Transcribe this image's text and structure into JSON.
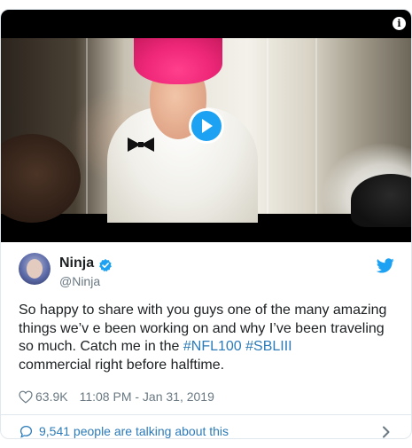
{
  "tweet": {
    "author_name": "Ninja",
    "author_handle": "@Ninja",
    "text_before": "So happy to share with you guys one of the many amazing things we’v e been working on and why I’ve been traveling so much. Catch me in the ",
    "hashtags": [
      "#NFL100",
      "#SBLIII"
    ],
    "text_after": "commercial right before halftime.",
    "likes": "63.9K",
    "timestamp": "11:08 PM - Jan 31, 2019",
    "conversation": "9,541 people are talking about this"
  },
  "video": {
    "info_glyph": "i"
  },
  "icons": {
    "play": "play-icon",
    "info": "info-icon",
    "verified": "verified-badge-icon",
    "bird": "twitter-bird-icon",
    "heart": "heart-icon",
    "bubble": "speech-bubble-icon",
    "chevron": "chevron-right-icon"
  },
  "colors": {
    "accent": "#1da1f2",
    "link": "#2b7bb9",
    "text": "#1c2022",
    "muted": "#697882",
    "border": "#e1e8ed"
  }
}
